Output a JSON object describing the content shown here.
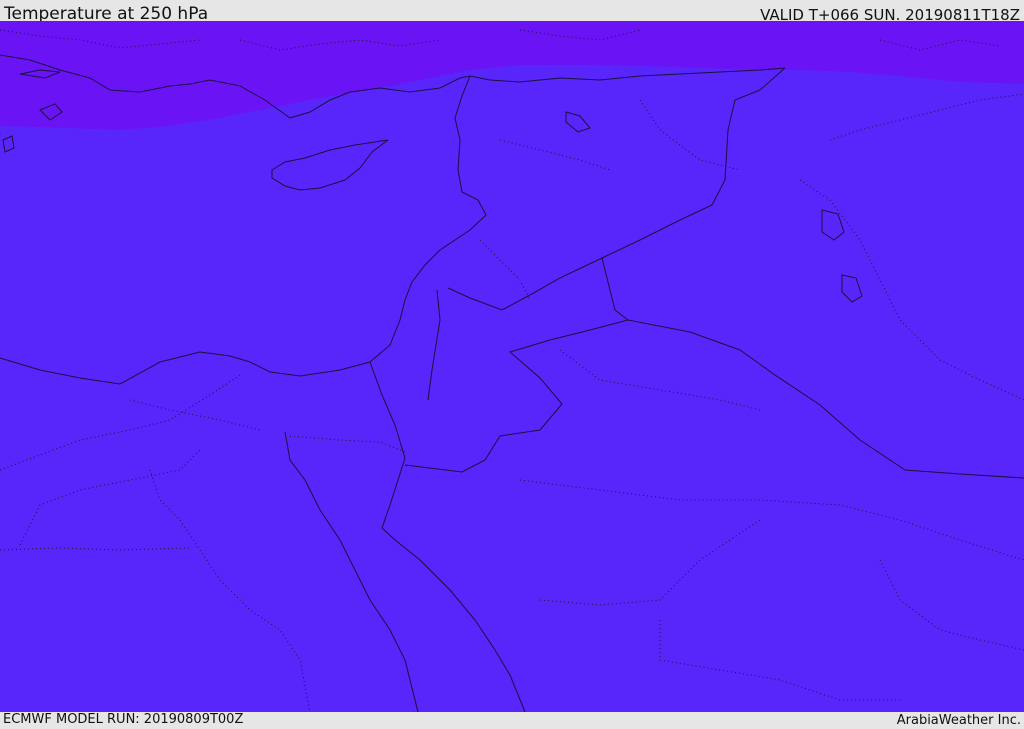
{
  "header": {
    "title": "Temperature at 250 hPa",
    "valid_time": "VALID T+066 SUN. 20190811T18Z"
  },
  "footer": {
    "model_run": "ECMWF MODEL RUN: 20190809T00Z",
    "credit": "ArabiaWeather Inc."
  },
  "map": {
    "field": "temperature",
    "level": "250 hPa",
    "colors": {
      "cold_band": "#6a14f5",
      "main_fill": "#5826fa",
      "coastline": "#1c1040",
      "border": "#1c1040"
    }
  }
}
